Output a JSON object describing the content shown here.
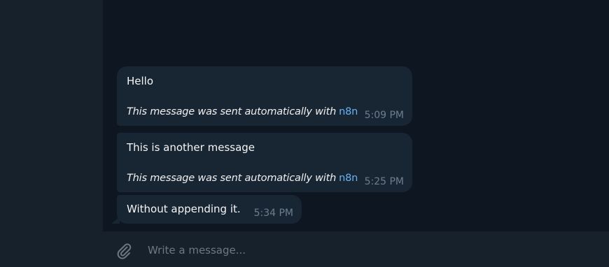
{
  "messages": [
    {
      "text": "Hello",
      "footer_prefix": "This message was sent automatically with",
      "footer_link": "n8n",
      "time": "5:09 PM"
    },
    {
      "text": "This is another message",
      "footer_prefix": "This message was sent automatically with",
      "footer_link": "n8n",
      "time": "5:25 PM"
    },
    {
      "text": "Without appending it.",
      "time": "5:34 PM"
    }
  ],
  "composer": {
    "placeholder": "Write a message...",
    "attach_icon": "paperclip-icon"
  },
  "colors": {
    "sidebar_bg": "#17212b",
    "chat_bg": "#0e1621",
    "bubble_bg": "#182533",
    "link": "#6ab3f3",
    "time": "#6d7f8f"
  }
}
